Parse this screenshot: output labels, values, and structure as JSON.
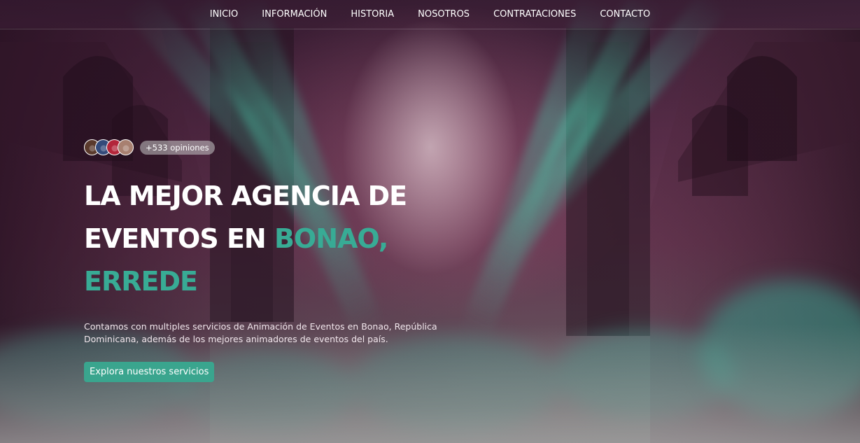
{
  "nav": {
    "items": [
      {
        "label": "INICIO"
      },
      {
        "label": "INFORMACIÓN"
      },
      {
        "label": "HISTORIA"
      },
      {
        "label": "NOSOTROS"
      },
      {
        "label": "CONTRATACIONES"
      },
      {
        "label": "CONTACTO"
      }
    ]
  },
  "hero": {
    "reviews_badge": "+533 opiniones",
    "avatar_colors": [
      "#5a3a2c",
      "#334a7a",
      "#b3263a",
      "#a88070"
    ],
    "headline_line1": "LA MEJOR AGENCIA DE",
    "headline_line2_prefix": "EVENTOS EN ",
    "headline_line2_accent": "BONAO,",
    "headline_line3_accent": "ERREDE",
    "description": "Contamos con multiples servicios de Animación de Eventos en Bonao, República Dominicana, además de los mejores animadores de eventos del país.",
    "cta_label": "Explora nuestros servicios"
  },
  "colors": {
    "accent": "#38ab95",
    "cta_background": "#3aa58e",
    "text": "#ffffff"
  }
}
